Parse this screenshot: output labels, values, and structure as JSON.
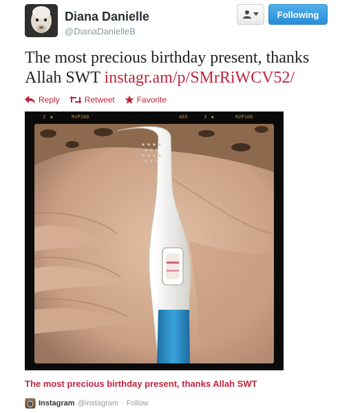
{
  "user": {
    "name": "Diana Danielle",
    "handle": "@DianaDanielleB"
  },
  "buttons": {
    "follow_label": "Following"
  },
  "tweet": {
    "text": "The most precious birthday present, thanks Allah SWT",
    "link": "instagr.am/p/SMrRiWCV52/"
  },
  "actions": {
    "reply": "Reply",
    "retweet": "Retweet",
    "favorite": "Favorite"
  },
  "photo": {
    "film_marks": [
      "2",
      "RVP100",
      "465",
      "3",
      "RVP100"
    ]
  },
  "caption": "The most precious birthday present, thanks Allah SWT",
  "source": {
    "name": "Instagram",
    "handle": "@instagram",
    "separator": "·",
    "follow": "Follow"
  },
  "colors": {
    "accent": "#c0243c",
    "follow_button": "#2a8ed6"
  }
}
